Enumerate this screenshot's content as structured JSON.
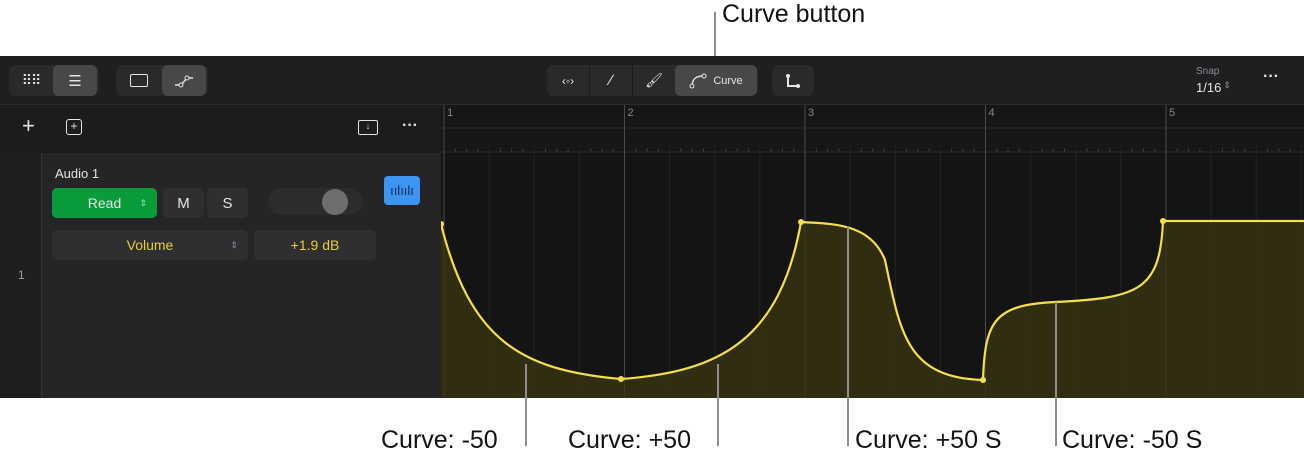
{
  "callouts": {
    "curve_button": "Curve button",
    "c1": "Curve: -50",
    "c2": "Curve: +50",
    "c3": "Curve: +50 S",
    "c4": "Curve: -50 S"
  },
  "toolbar": {
    "curve_label": "Curve",
    "snap_label": "Snap",
    "snap_value": "1/16"
  },
  "track": {
    "number": "1",
    "name": "Audio 1",
    "mode": "Read",
    "mute": "M",
    "solo": "S",
    "parameter": "Volume",
    "value": "+1.9 dB"
  },
  "ruler": {
    "bars": [
      "1",
      "2",
      "3",
      "4",
      "5"
    ]
  },
  "colors": {
    "accent_green": "#0a9b3a",
    "curve": "#f5e04a",
    "region_blue": "#3d95f2"
  }
}
